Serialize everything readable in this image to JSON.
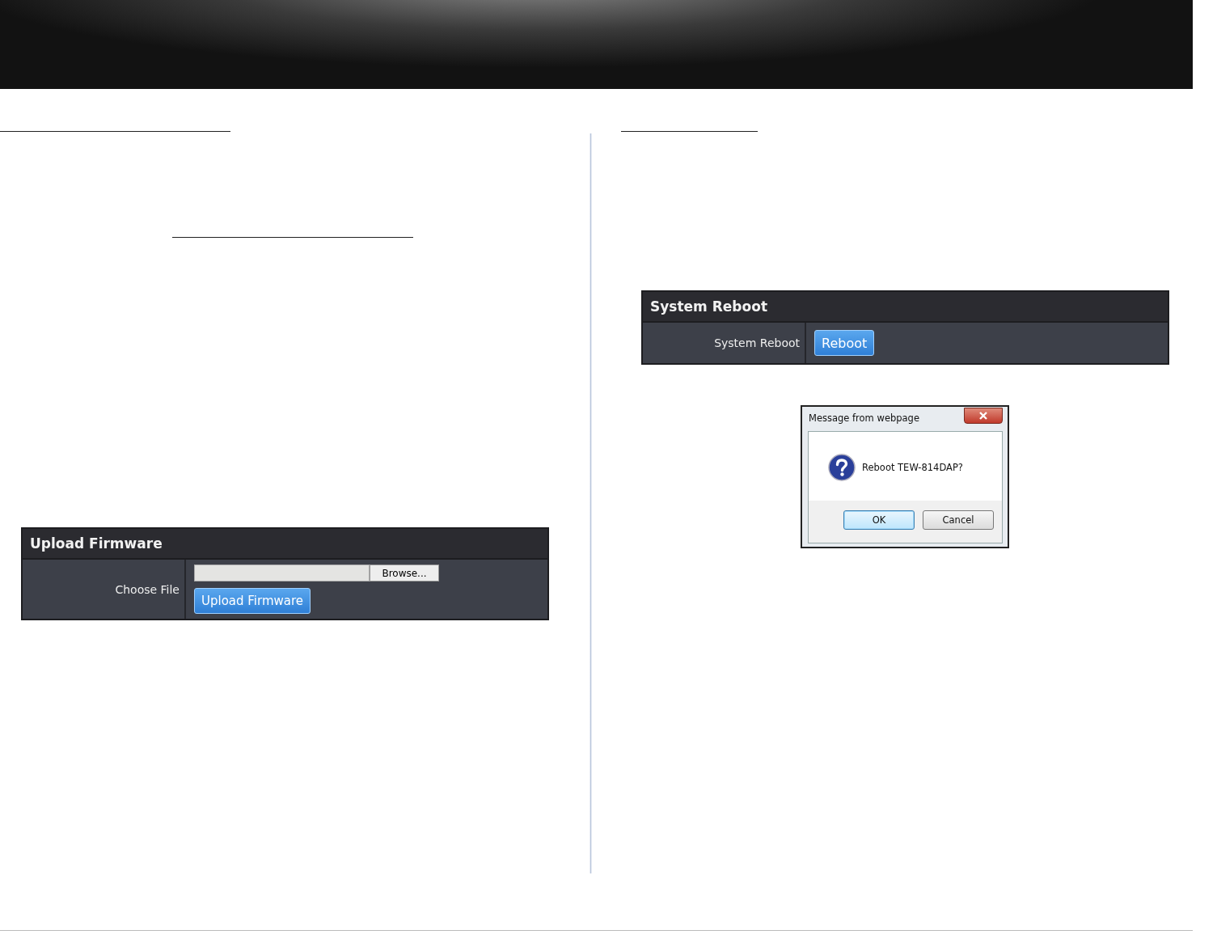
{
  "upload_panel": {
    "title": "Upload Firmware",
    "label": "Choose File",
    "browse_button": "Browse...",
    "upload_button": "Upload Firmware"
  },
  "reboot_panel": {
    "title": "System Reboot",
    "label": "System Reboot",
    "button": "Reboot"
  },
  "dialog": {
    "title": "Message from webpage",
    "message": "Reboot TEW-814DAP?",
    "buttons": [
      {
        "label": "OK",
        "selected": true
      },
      {
        "label": "Cancel",
        "selected": false
      }
    ]
  }
}
